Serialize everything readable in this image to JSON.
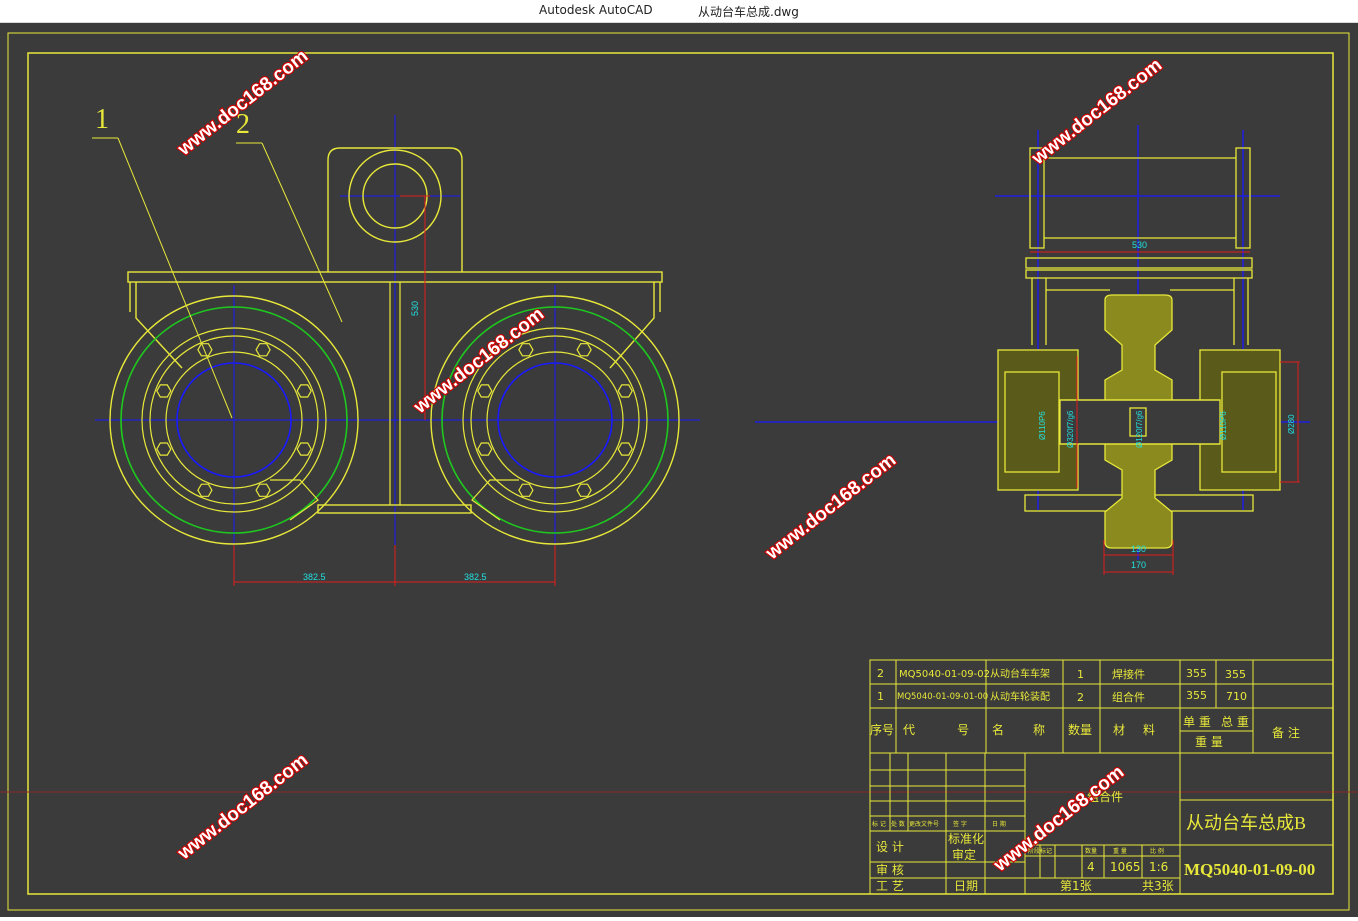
{
  "window": {
    "app_title": "Autodesk AutoCAD",
    "file_title": "从动台车总成.dwg"
  },
  "colors": {
    "background": "#3b3b3b",
    "frame": "#e8e83a",
    "centerline": "#1a1aff",
    "wheel_tread": "#1ec81e",
    "dimension": "#e01c1c",
    "dimension_text": "#22e0e0",
    "watermark": "#ffffff"
  },
  "drawing": {
    "leaders": [
      "1",
      "2"
    ],
    "dims": {
      "height_530": "530",
      "span_left": "382.5",
      "span_right": "382.5",
      "side_530": "530",
      "side_130": "130",
      "side_170": "170",
      "dia_a": "Ø110P6",
      "dia_b": "Ø320f7/g6",
      "dia_c": "Ø120f7/g6",
      "dia_d": "Ø110P6",
      "dia_e": "Ø280"
    },
    "watermark": "www.doc168.com"
  },
  "title_block": {
    "parts": [
      {
        "no": "2",
        "code": "MQ5040-01-09-02",
        "name": "从动台车车架",
        "qty": "1",
        "material": "焊接件",
        "unit_weight": "355",
        "total_weight": "355",
        "remark": ""
      },
      {
        "no": "1",
        "code": "MQ5040-01-09-01-00",
        "name": "从动车轮装配",
        "qty": "2",
        "material": "组合件",
        "unit_weight": "355",
        "total_weight": "710",
        "remark": ""
      }
    ],
    "header": {
      "no": "序号",
      "code_a": "代",
      "code_b": "号",
      "name_a": "名",
      "name_b": "称",
      "qty": "数量",
      "material_a": "材",
      "material_b": "料",
      "unit_weight": "单 重",
      "total_weight": "总 重",
      "weight": "重    量",
      "remark": "备 注"
    },
    "revision_labels": [
      "标 记",
      "处 数",
      "更改文件号",
      "签 字",
      "日 期"
    ],
    "material_note": "组合件",
    "roles": {
      "design": "设 计",
      "standard": "标准化",
      "check": "审 核",
      "approve": "审定",
      "process": "工 艺",
      "date": "日期"
    },
    "stage_labels": [
      "阶段标记",
      "数量",
      "重 量",
      "比 例"
    ],
    "quantity": "4",
    "weight": "1065",
    "scale": "1:6",
    "sheet": "第1张",
    "sheets_total": "共3张",
    "drawing_title": "从动台车总成B",
    "drawing_number": "MQ5040-01-09-00"
  }
}
